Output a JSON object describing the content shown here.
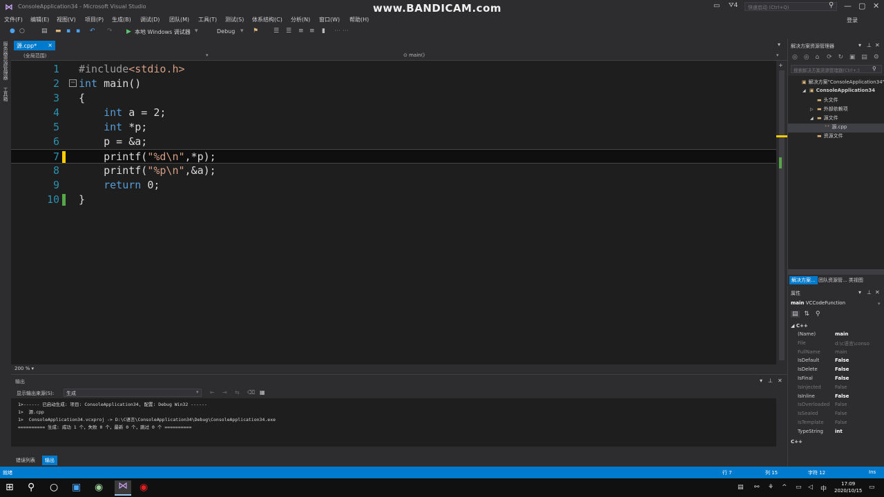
{
  "window": {
    "title": "ConsoleApplication34 - Microsoft Visual Studio",
    "watermark": "www.BANDICAM.com",
    "notif_count": "4",
    "quick_launch_placeholder": "快速启动 (Ctrl+Q)",
    "login": "登录"
  },
  "menu": [
    "文件(F)",
    "编辑(E)",
    "视图(V)",
    "项目(P)",
    "生成(B)",
    "调试(D)",
    "团队(M)",
    "工具(T)",
    "测试(S)",
    "体系结构(C)",
    "分析(N)",
    "窗口(W)",
    "帮助(H)"
  ],
  "toolbar": {
    "run_label": "本地 Windows 调试器",
    "config": "Debug"
  },
  "left_strip": {
    "server_explorer": "服务器资源管理器",
    "toolbox": "工具箱"
  },
  "doc_tab": {
    "label": "源.cpp*",
    "close": "×"
  },
  "navbar": {
    "scope": "(全局范围)",
    "function": "main()"
  },
  "code_lines": [
    {
      "n": "1",
      "tokens": [
        {
          "c": "pp",
          "t": "#include"
        },
        {
          "c": "inc",
          "t": "<stdio.h>"
        }
      ]
    },
    {
      "n": "2",
      "tokens": [
        {
          "c": "kw",
          "t": "int"
        },
        {
          "c": "",
          "t": " main()"
        }
      ]
    },
    {
      "n": "3",
      "tokens": [
        {
          "c": "",
          "t": "{"
        }
      ]
    },
    {
      "n": "4",
      "tokens": [
        {
          "c": "",
          "t": "    "
        },
        {
          "c": "kw",
          "t": "int"
        },
        {
          "c": "",
          "t": " a = 2;"
        }
      ]
    },
    {
      "n": "5",
      "tokens": [
        {
          "c": "",
          "t": "    "
        },
        {
          "c": "kw",
          "t": "int"
        },
        {
          "c": "",
          "t": " *p;"
        }
      ]
    },
    {
      "n": "6",
      "tokens": [
        {
          "c": "",
          "t": "    p = &a;"
        }
      ]
    },
    {
      "n": "7",
      "tokens": [
        {
          "c": "",
          "t": "    printf("
        },
        {
          "c": "str",
          "t": "\"%d\\n\""
        },
        {
          "c": "",
          "t": ",*p);"
        }
      ]
    },
    {
      "n": "8",
      "tokens": [
        {
          "c": "",
          "t": "    printf("
        },
        {
          "c": "str",
          "t": "\"%p\\n\""
        },
        {
          "c": "",
          "t": ",&a);"
        }
      ]
    },
    {
      "n": "9",
      "tokens": [
        {
          "c": "",
          "t": "    "
        },
        {
          "c": "kw",
          "t": "return"
        },
        {
          "c": "",
          "t": " 0;"
        }
      ]
    },
    {
      "n": "10",
      "tokens": [
        {
          "c": "",
          "t": "}"
        }
      ]
    }
  ],
  "zoom": "200 %",
  "output": {
    "title": "输出",
    "source_label": "显示输出来源(S):",
    "source_value": "生成",
    "lines": [
      "1>------ 已启动生成: 项目: ConsoleApplication34, 配置: Debug Win32 ------",
      "1>  源.cpp",
      "1>  ConsoleApplication34.vcxproj -> D:\\C语言\\ConsoleApplication34\\Debug\\ConsoleApplication34.exe",
      "========== 生成: 成功 1 个，失败 0 个，最新 0 个，跳过 0 个 =========="
    ],
    "tab_errors": "错误列表",
    "tab_output": "输出"
  },
  "solution_explorer": {
    "title": "解决方案资源管理器",
    "search_placeholder": "搜索解决方案资源管理器(Ctrl+;)",
    "tree": [
      {
        "label": "解决方案\"ConsoleApplication34\"",
        "indent": 0,
        "arrow": "",
        "bold": false,
        "sel": false
      },
      {
        "label": "ConsoleApplication34",
        "indent": 1,
        "arrow": "◢",
        "bold": true,
        "sel": false
      },
      {
        "label": "头文件",
        "indent": 2,
        "arrow": "",
        "bold": false,
        "sel": false
      },
      {
        "label": "外部依赖项",
        "indent": 2,
        "arrow": "▷",
        "bold": false,
        "sel": false
      },
      {
        "label": "源文件",
        "indent": 2,
        "arrow": "◢",
        "bold": false,
        "sel": false
      },
      {
        "label": "源.cpp",
        "indent": 3,
        "arrow": "",
        "bold": false,
        "sel": true
      },
      {
        "label": "资源文件",
        "indent": 2,
        "arrow": "",
        "bold": false,
        "sel": false
      }
    ],
    "tab_solution": "解决方案...",
    "tab_team": "团队资源管...  类视图"
  },
  "properties": {
    "title": "属性",
    "object_name": "main",
    "object_type": "VCCodeFunction",
    "category": "C++",
    "rows": [
      {
        "k": "(Name)",
        "v": "main",
        "dim": false
      },
      {
        "k": "File",
        "v": "d:\\c语言\\conso",
        "dim": true
      },
      {
        "k": "FullName",
        "v": "main",
        "dim": true
      },
      {
        "k": "IsDefault",
        "v": "False",
        "dim": false
      },
      {
        "k": "IsDelete",
        "v": "False",
        "dim": false
      },
      {
        "k": "IsFinal",
        "v": "False",
        "dim": false
      },
      {
        "k": "IsInjected",
        "v": "False",
        "dim": true
      },
      {
        "k": "IsInline",
        "v": "False",
        "dim": false
      },
      {
        "k": "IsOverloaded",
        "v": "False",
        "dim": true
      },
      {
        "k": "IsSealed",
        "v": "False",
        "dim": true
      },
      {
        "k": "IsTemplate",
        "v": "False",
        "dim": true
      },
      {
        "k": "TypeString",
        "v": "int",
        "dim": false
      }
    ],
    "footer": "C++"
  },
  "status": {
    "ready": "就绪",
    "line": "行 7",
    "col": "列 15",
    "char": "字符 12",
    "ins": "Ins"
  },
  "taskbar": {
    "time": "17:09",
    "date": "2020/10/15"
  }
}
